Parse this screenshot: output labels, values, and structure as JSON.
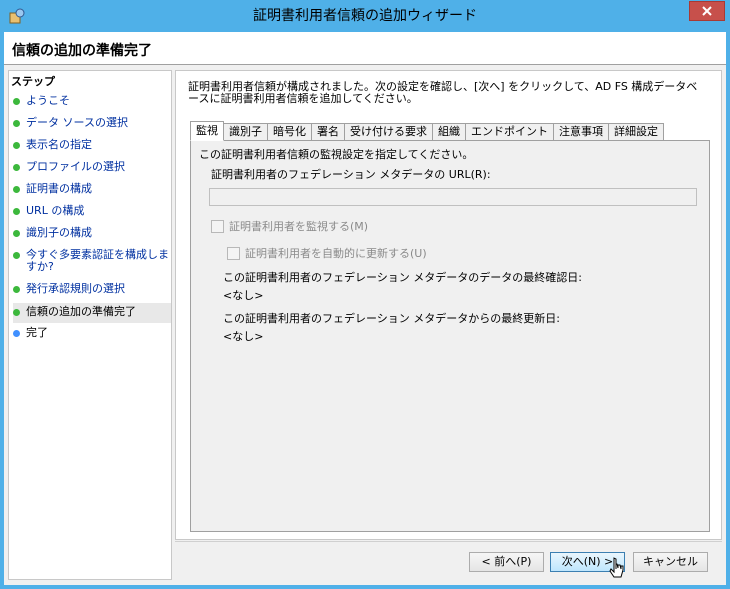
{
  "window": {
    "title": "証明書利用者信頼の追加ウィザード"
  },
  "header": {
    "title": "信頼の追加の準備完了"
  },
  "steps": {
    "title": "ステップ",
    "items": [
      {
        "label": "ようこそ"
      },
      {
        "label": "データ ソースの選択"
      },
      {
        "label": "表示名の指定"
      },
      {
        "label": "プロファイルの選択"
      },
      {
        "label": "証明書の構成"
      },
      {
        "label": "URL の構成"
      },
      {
        "label": "識別子の構成"
      },
      {
        "label": "今すぐ多要素認証を構成しますか?"
      },
      {
        "label": "発行承認規則の選択"
      },
      {
        "label": "信頼の追加の準備完了"
      },
      {
        "label": "完了"
      }
    ]
  },
  "content": {
    "description": "証明書利用者信頼が構成されました。次の設定を確認し、[次へ] をクリックして、AD FS 構成データベースに証明書利用者信頼を追加してください。",
    "tabs": [
      "監視",
      "識別子",
      "暗号化",
      "署名",
      "受け付ける要求",
      "組織",
      "エンドポイント",
      "注意事項",
      "詳細設定"
    ],
    "panel": {
      "intro": "この証明書利用者信頼の監視設定を指定してください。",
      "url_label": "証明書利用者のフェデレーション メタデータの URL(R):",
      "url_value": "",
      "monitor_label": "証明書利用者を監視する(M)",
      "auto_update_label": "証明書利用者を自動的に更新する(U)",
      "last_check_label": "この証明書利用者のフェデレーション メタデータのデータの最終確認日:",
      "last_check_value": "<なし>",
      "last_update_label": "この証明書利用者のフェデレーション メタデータからの最終更新日:",
      "last_update_value": "<なし>"
    }
  },
  "footer": {
    "back_label": "< 前へ(P)",
    "next_label": "次へ(N) >",
    "cancel_label": "キャンセル"
  },
  "colors": {
    "titlebar": "#4fb0e8",
    "close": "#c7504b",
    "step_link": "#0030a0",
    "step_done_dot": "#3cb83c",
    "step_current_dot": "#4090ff"
  }
}
